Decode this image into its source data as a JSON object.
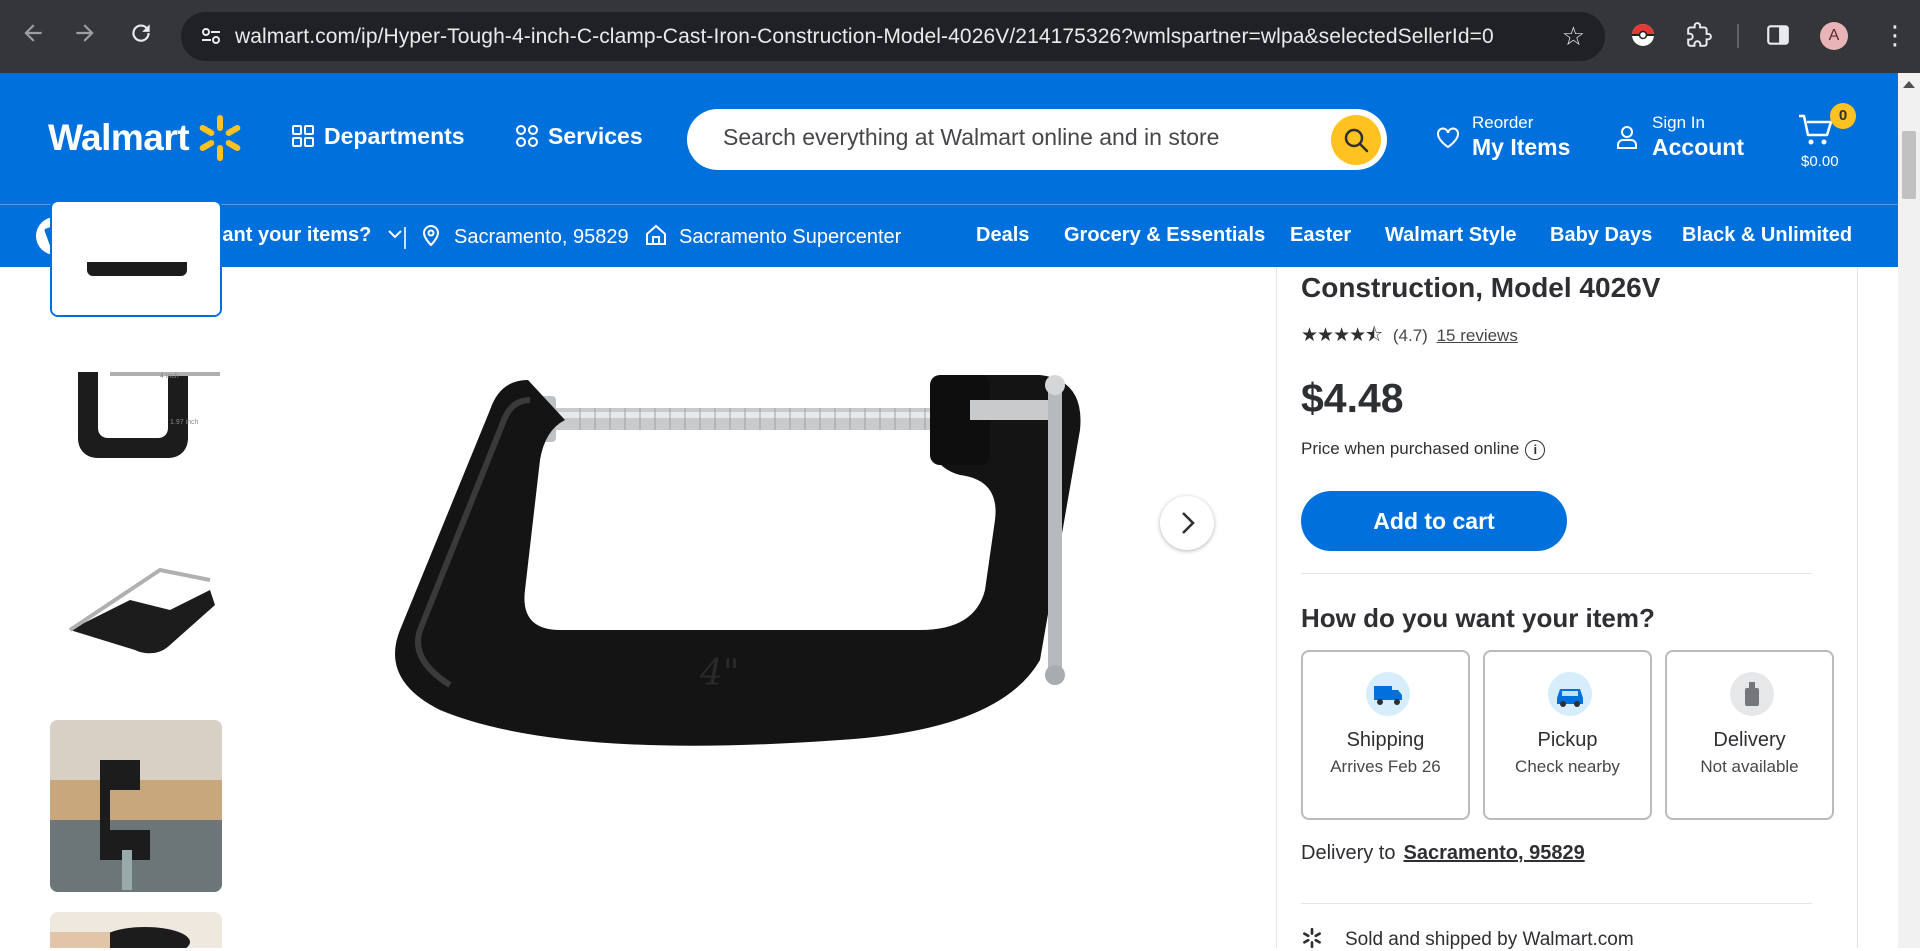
{
  "browser": {
    "url": "walmart.com/ip/Hyper-Tough-4-inch-C-clamp-Cast-Iron-Construction-Model-4026V/214175326?wmlspartner=wlpa&selectedSellerId=0",
    "avatar_letter": "A"
  },
  "header": {
    "logo": "Walmart",
    "departments": "Departments",
    "services": "Services",
    "search_placeholder": "Search everything at Walmart online and in store",
    "reorder_small": "Reorder",
    "reorder_large": "My Items",
    "signin_small": "Sign In",
    "signin_large": "Account",
    "cart_count": "0",
    "cart_total": "$0.00",
    "brand_blue": "#0071dc",
    "brand_yellow": "#ffc220"
  },
  "subnav": {
    "fulfillment": "How do you want your items?",
    "location": "Sacramento, 95829",
    "store": "Sacramento Supercenter",
    "links": [
      "Deals",
      "Grocery & Essentials",
      "Easter",
      "Walmart Style",
      "Baby Days",
      "Black & Unlimited"
    ]
  },
  "product": {
    "title_partial": "Construction, Model 4026V",
    "rating_value": "(4.7)",
    "reviews": "15 reviews",
    "stars": "★★★★⯪",
    "price": "$4.48",
    "price_note": "Price when purchased online",
    "add_to_cart": "Add to cart",
    "how_question": "How do you want your item?",
    "options": [
      {
        "title": "Shipping",
        "sub": "Arrives Feb 26"
      },
      {
        "title": "Pickup",
        "sub": "Check nearby"
      },
      {
        "title": "Delivery",
        "sub": "Not available"
      }
    ],
    "delivery_to_label": "Delivery to",
    "delivery_to_location": "Sacramento, 95829",
    "sold_by": "Sold and shipped by Walmart.com",
    "main_image_mark": "4\"",
    "thumb2_text_a": "4 inch",
    "thumb2_text_b": "1.97 inch"
  }
}
